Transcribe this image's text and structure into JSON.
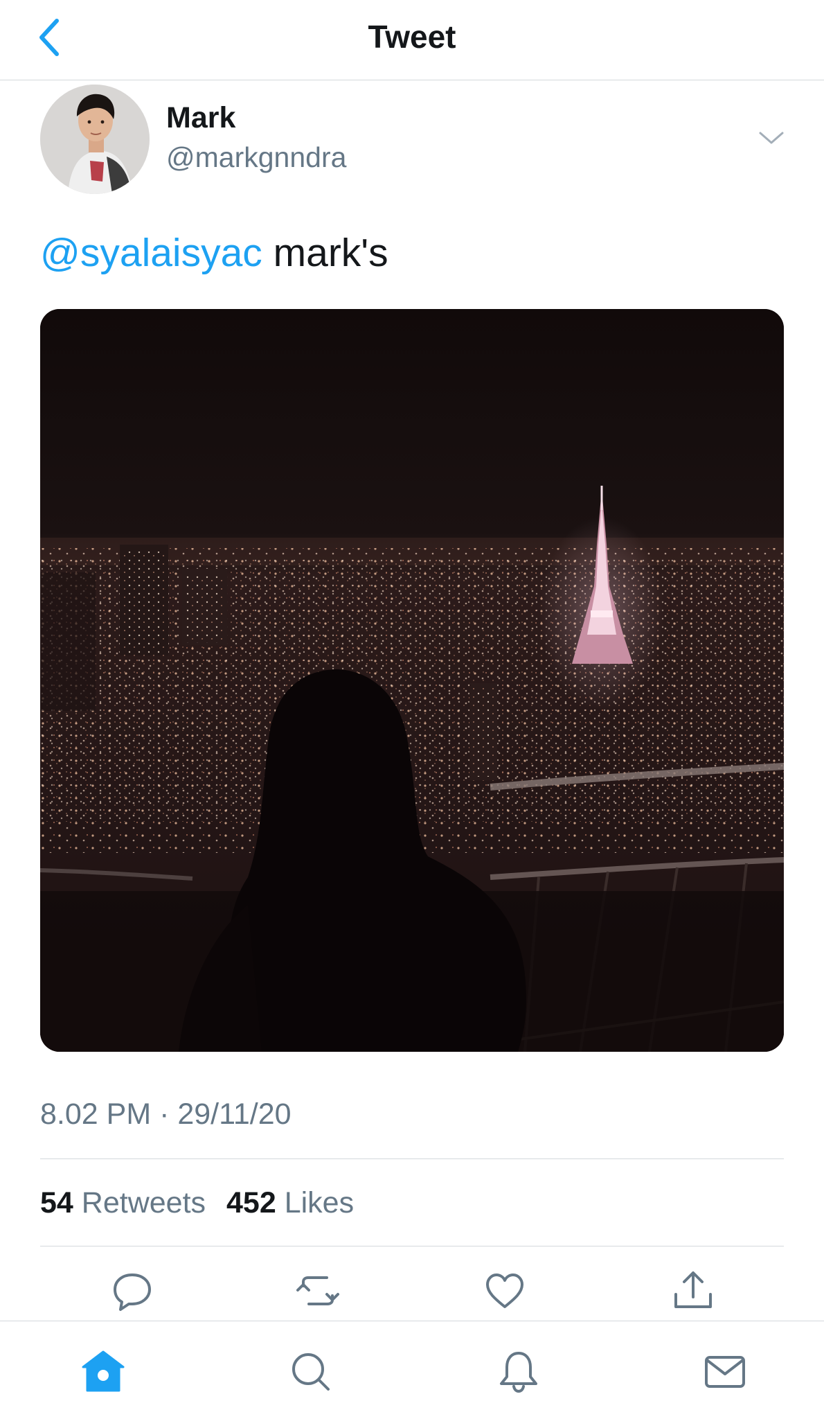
{
  "header": {
    "title": "Tweet"
  },
  "tweet": {
    "author_name": "Mark",
    "author_handle": "@markgnndra",
    "mention": "@syalaisyac",
    "text": " mark's",
    "timestamp": "8.02 PM · 29/11/20"
  },
  "stats": {
    "retweets_count": "54",
    "retweets_label": " Retweets",
    "likes_count": "452",
    "likes_label": " Likes"
  },
  "colors": {
    "accent": "#1da1f2",
    "text_primary": "#14171a",
    "text_secondary": "#657786",
    "divider": "#d4d8dc"
  },
  "icons": {
    "header": [
      "back-chevron-icon"
    ],
    "author": [
      "caret-down-icon"
    ],
    "actions": [
      "reply-icon",
      "retweet-icon",
      "like-icon",
      "share-icon"
    ],
    "tabs": [
      "home-icon",
      "search-icon",
      "notifications-icon",
      "messages-icon"
    ]
  }
}
